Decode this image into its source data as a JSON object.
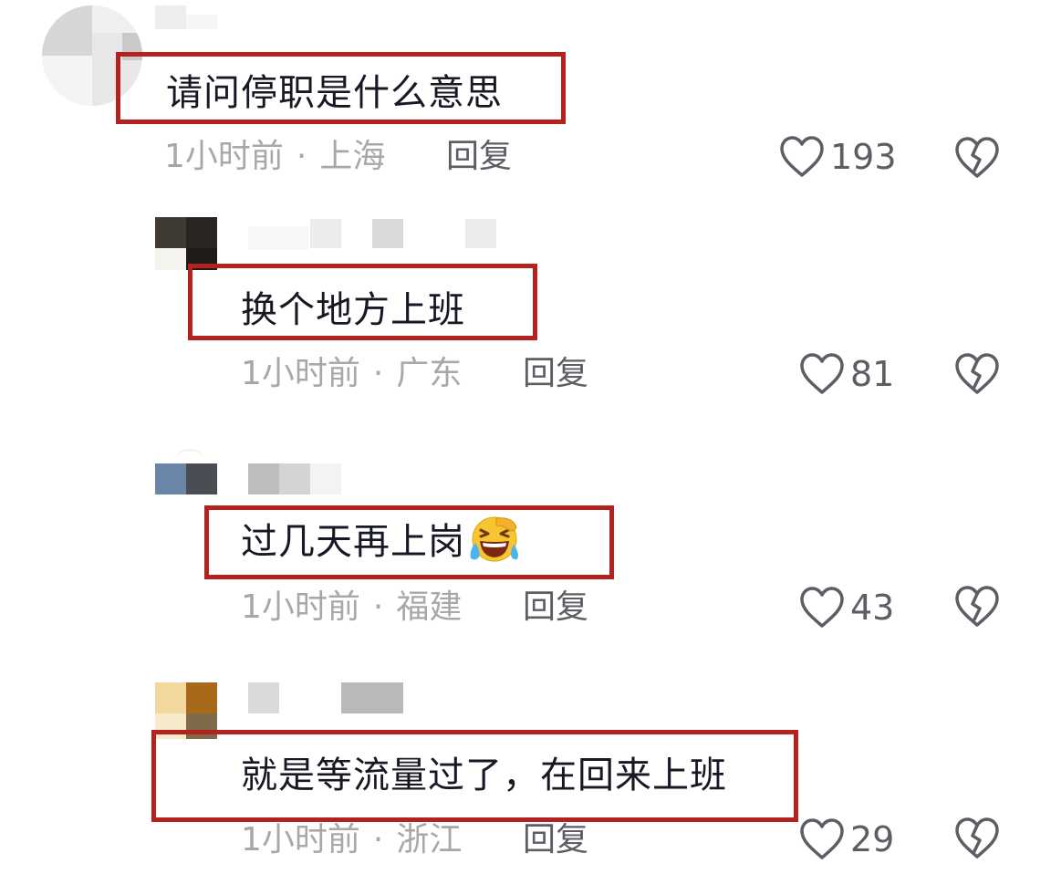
{
  "comments": [
    {
      "text": "请问停职是什么意思",
      "time": "1小时前",
      "location": "上海",
      "reply_label": "回复",
      "likes": "193"
    },
    {
      "text": "换个地方上班",
      "time": "1小时前",
      "location": "广东",
      "reply_label": "回复",
      "likes": "81"
    },
    {
      "text": "过几天再上岗",
      "emoji": "laughing-crying-emoji",
      "time": "1小时前",
      "location": "福建",
      "reply_label": "回复",
      "likes": "43"
    },
    {
      "text": "就是等流量过了，在回来上班",
      "time": "1小时前",
      "location": "浙江",
      "reply_label": "回复",
      "likes": "29"
    }
  ],
  "meta_separator": "·",
  "colors": {
    "highlight_border": "#b3221f",
    "text": "#161823",
    "meta": "#a7a8ac",
    "action": "#5c5e66"
  },
  "icons": {
    "like": "heart-outline-icon",
    "dislike": "broken-heart-icon"
  }
}
